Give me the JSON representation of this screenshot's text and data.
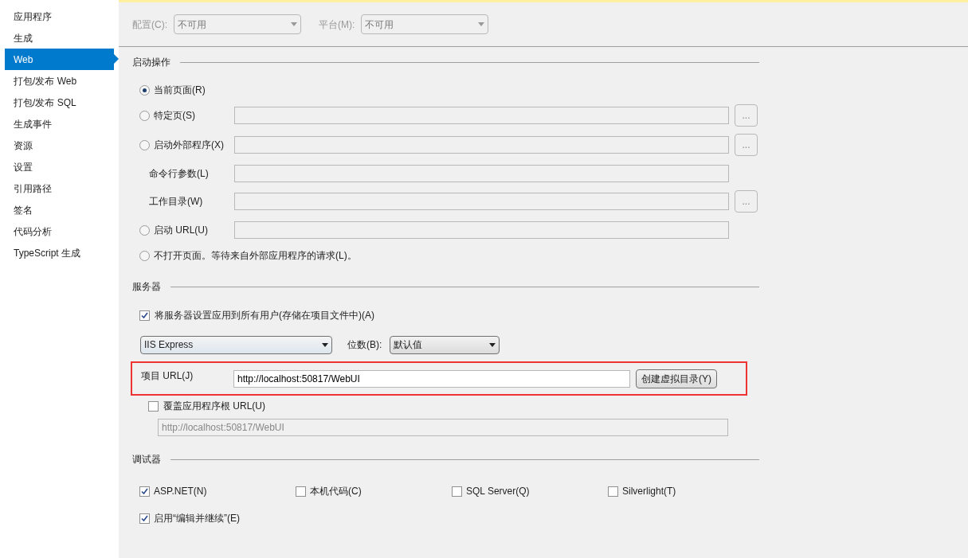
{
  "sidebar": {
    "items": [
      {
        "label": "应用程序",
        "selected": false
      },
      {
        "label": "生成",
        "selected": false
      },
      {
        "label": "Web",
        "selected": true
      },
      {
        "label": "打包/发布 Web",
        "selected": false
      },
      {
        "label": "打包/发布 SQL",
        "selected": false
      },
      {
        "label": "生成事件",
        "selected": false
      },
      {
        "label": "资源",
        "selected": false
      },
      {
        "label": "设置",
        "selected": false
      },
      {
        "label": "引用路径",
        "selected": false
      },
      {
        "label": "签名",
        "selected": false
      },
      {
        "label": "代码分析",
        "selected": false
      },
      {
        "label": "TypeScript 生成",
        "selected": false
      }
    ]
  },
  "toolbar": {
    "configuration": {
      "label": "配置(C):",
      "value": "不可用",
      "disabled": true
    },
    "platform": {
      "label": "平台(M):",
      "value": "不可用",
      "disabled": true
    }
  },
  "start_action": {
    "title": "启动操作",
    "options": [
      {
        "kind": "radio",
        "label": "当前页面(R)",
        "selected": true
      },
      {
        "kind": "radio",
        "label": "特定页(S)",
        "selected": false,
        "field": true,
        "browse": "..."
      },
      {
        "kind": "radio",
        "label": "启动外部程序(X)",
        "selected": false,
        "field": true,
        "browse": "..."
      },
      {
        "kind": "label",
        "label": "命令行参数(L)",
        "field": true
      },
      {
        "kind": "label",
        "label": "工作目录(W)",
        "field": true,
        "browse": "..."
      },
      {
        "kind": "radio",
        "label": "启动 URL(U)",
        "selected": false,
        "field": true
      },
      {
        "kind": "radio",
        "label": "不打开页面。等待来自外部应用程序的请求(L)。",
        "selected": false
      }
    ]
  },
  "servers": {
    "title": "服务器",
    "apply_all": {
      "label": "将服务器设置应用到所有用户(存储在项目文件中)(A)",
      "checked": true
    },
    "server": {
      "value": "IIS Express"
    },
    "bitness": {
      "label": "位数(B):",
      "value": "默认值"
    },
    "project_url": {
      "label": "项目 URL(J)",
      "value": "http://localhost:50817/WebUI",
      "button": "创建虚拟目录(Y)",
      "highlighted": true
    },
    "override_root": {
      "label": "覆盖应用程序根 URL(U)",
      "checked": false
    },
    "override_url": {
      "value": "http://localhost:50817/WebUI",
      "disabled": true
    }
  },
  "debuggers": {
    "title": "调试器",
    "options": [
      {
        "label": "ASP.NET(N)",
        "checked": true
      },
      {
        "label": "本机代码(C)",
        "checked": false
      },
      {
        "label": "SQL Server(Q)",
        "checked": false
      },
      {
        "label": "Silverlight(T)",
        "checked": false
      }
    ],
    "edit_continue": {
      "label": "启用“编辑并继续”(E)",
      "checked": true
    }
  }
}
